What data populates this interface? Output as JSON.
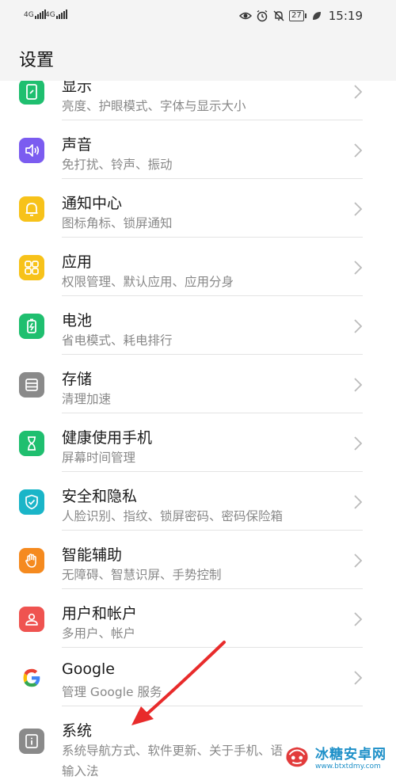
{
  "status_bar": {
    "sim1": "4G",
    "sim2": "4G",
    "battery": "27",
    "time": "15:19",
    "icons": [
      "eye-icon",
      "alarm-icon",
      "bell-off-icon",
      "battery-icon",
      "leaf-icon"
    ]
  },
  "header": {
    "title": "设置"
  },
  "items": [
    {
      "title": "显示",
      "subtitle": "亮度、护眼模式、字体与显示大小",
      "icon": "display-icon",
      "color": "#1fbf6f"
    },
    {
      "title": "声音",
      "subtitle": "免打扰、铃声、振动",
      "icon": "sound-icon",
      "color": "#7b5cf0"
    },
    {
      "title": "通知中心",
      "subtitle": "图标角标、锁屏通知",
      "icon": "bell-icon",
      "color": "#f7c21a"
    },
    {
      "title": "应用",
      "subtitle": "权限管理、默认应用、应用分身",
      "icon": "apps-icon",
      "color": "#f7c21a"
    },
    {
      "title": "电池",
      "subtitle": "省电模式、耗电排行",
      "icon": "battery-icon",
      "color": "#1fbf6f"
    },
    {
      "title": "存储",
      "subtitle": "清理加速",
      "icon": "storage-icon",
      "color": "#8a8a8a"
    },
    {
      "title": "健康使用手机",
      "subtitle": "屏幕时间管理",
      "icon": "hourglass-icon",
      "color": "#1fbf6f"
    },
    {
      "title": "安全和隐私",
      "subtitle": "人脸识别、指纹、锁屏密码、密码保险箱",
      "icon": "shield-icon",
      "color": "#1ab5c8"
    },
    {
      "title": "智能辅助",
      "subtitle": "无障碍、智慧识屏、手势控制",
      "icon": "hand-icon",
      "color": "#f58a1f"
    },
    {
      "title": "用户和帐户",
      "subtitle": "多用户、帐户",
      "icon": "user-icon",
      "color": "#ef5350"
    },
    {
      "title": "Google",
      "subtitle": "管理 Google 服务",
      "icon": "google-icon",
      "color": "#ffffff"
    },
    {
      "title": "系统",
      "subtitle": "系统导航方式、软件更新、关于手机、语",
      "subtitle2": "输入法",
      "icon": "system-info-icon",
      "color": "#8a8a8a"
    }
  ],
  "watermark": {
    "title": "冰糖安卓网",
    "url": "www.btxtdmy.com"
  }
}
